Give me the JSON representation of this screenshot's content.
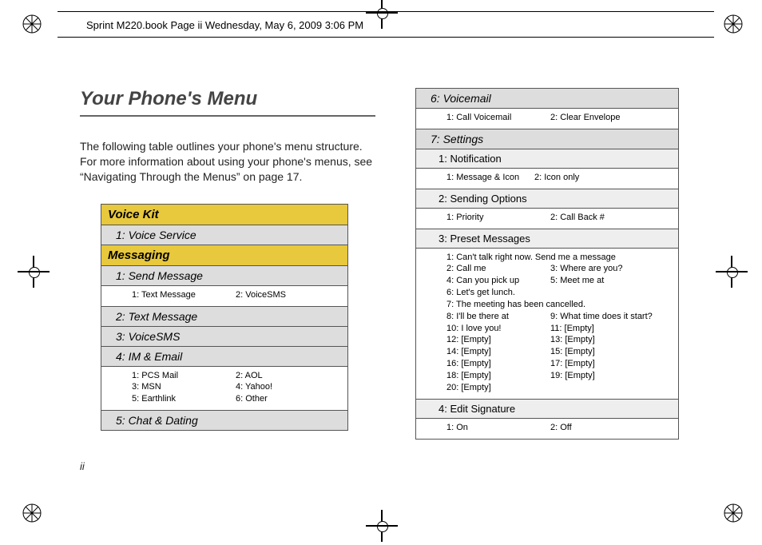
{
  "header_text": "Sprint M220.book  Page ii  Wednesday, May 6, 2009  3:06 PM",
  "title": "Your Phone's Menu",
  "intro": "The following table outlines your phone's menu structure. For more information about using your phone's menus, see “Navigating Through the Menus” on page 17.",
  "page_number": "ii",
  "left": {
    "voice_kit": "Voice Kit",
    "voice_service": "1: Voice Service",
    "messaging": "Messaging",
    "send_message": "1: Send Message",
    "send_message_items": {
      "a": "1: Text Message",
      "b": "2: VoiceSMS"
    },
    "text_message": "2: Text Message",
    "voicesms": "3: VoiceSMS",
    "im_email": "4: IM & Email",
    "im_items": {
      "a": "1: PCS Mail",
      "b": "2: AOL",
      "c": "3: MSN",
      "d": "4: Yahoo!",
      "e": "5: Earthlink",
      "f": "6: Other"
    },
    "chat_dating": "5: Chat & Dating"
  },
  "right": {
    "voicemail": "6: Voicemail",
    "voicemail_items": {
      "a": "1: Call Voicemail",
      "b": "2: Clear Envelope"
    },
    "settings": "7: Settings",
    "notification": "1: Notification",
    "notification_items": {
      "a": "1: Message & Icon",
      "b": "2: Icon only"
    },
    "sending_options": "2: Sending Options",
    "sending_items": {
      "a": "1: Priority",
      "b": "2: Call Back #"
    },
    "preset_messages": "3: Preset Messages",
    "preset_items": {
      "l1a": "1: Can't talk right now. Send me a message",
      "l2a": "2: Call me",
      "l2b": "3: Where are you?",
      "l3a": "4: Can you pick up",
      "l3b": "5: Meet me at",
      "l4a": "6: Let's get lunch.",
      "l5a": "7: The meeting has been cancelled.",
      "l6a": "8: I'll be there at",
      "l6b": "9: What time does it start?",
      "l7a": "10: I love you!",
      "l7b": "11: [Empty]",
      "l8a": "12: [Empty]",
      "l8b": "13: [Empty]",
      "l9a": "14: [Empty]",
      "l9b": "15: [Empty]",
      "l10a": "16: [Empty]",
      "l10b": "17: [Empty]",
      "l11a": "18: [Empty]",
      "l11b": "19: [Empty]",
      "l12a": "20: [Empty]"
    },
    "edit_signature": "4: Edit Signature",
    "edit_items": {
      "a": "1: On",
      "b": "2: Off"
    }
  }
}
